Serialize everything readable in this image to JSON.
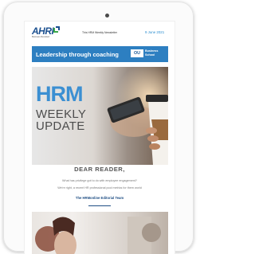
{
  "email": {
    "logo_text": "AHRI",
    "logo_tag": "Business Revisited",
    "header_title": "This HRM Weekly Newsletter",
    "date": "9 June 2021",
    "banner": {
      "text": "Leadership through coaching",
      "partner_short": "OU",
      "partner_name": "Business School"
    },
    "hero": {
      "line1": "HRM",
      "line2": "WEEKLY",
      "line3": "UPDATE"
    },
    "greeting": "DEAR READER,",
    "intro_line1": "What has privilege got to do with employee engagement?",
    "intro_line2": "We're right, a recent HR professional pool metrics for them world",
    "signoff": "The HRMonline Editorial Team"
  },
  "colors": {
    "brand_blue": "#2d7fc1",
    "navy": "#1f4e84",
    "hrm_blue": "#3b8fd2"
  }
}
